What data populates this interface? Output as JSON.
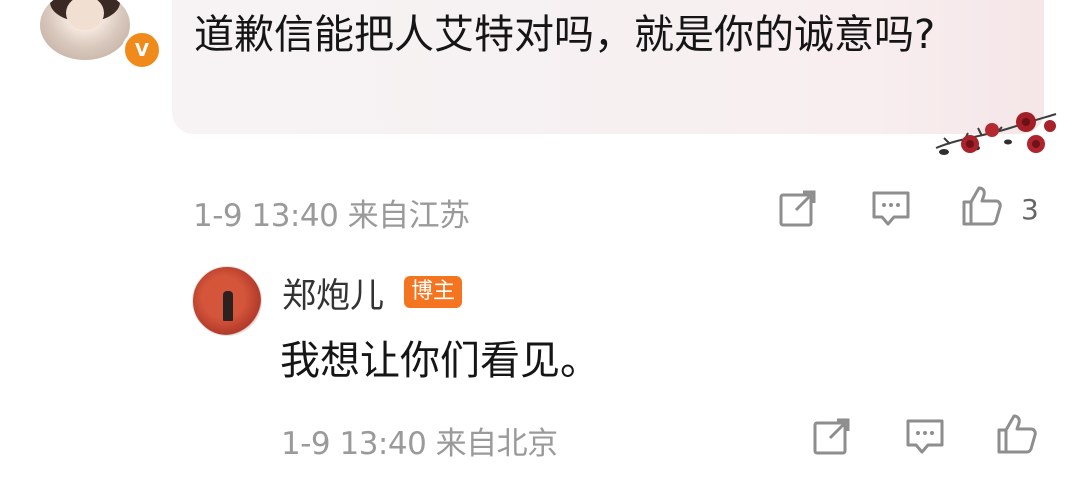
{
  "comment": {
    "text": "道歉信能把人艾特对吗，就是你的诚意吗?",
    "verify_badge": "V",
    "meta": "1-9 13:40 来自江苏",
    "like_count": "3",
    "icons": [
      "share-icon",
      "reply-icon",
      "like-icon"
    ]
  },
  "reply": {
    "username": "郑炮儿",
    "badge": "博主",
    "text": "我想让你们看见。",
    "meta": "1-9 13:40 来自北京",
    "icons": [
      "share-icon",
      "reply-icon",
      "like-icon"
    ]
  },
  "colors": {
    "verify_badge": "#f08a1a",
    "blogger_badge": "#f5741f",
    "meta_text": "#9a9a9a",
    "icon_stroke": "#8e8e8e"
  }
}
